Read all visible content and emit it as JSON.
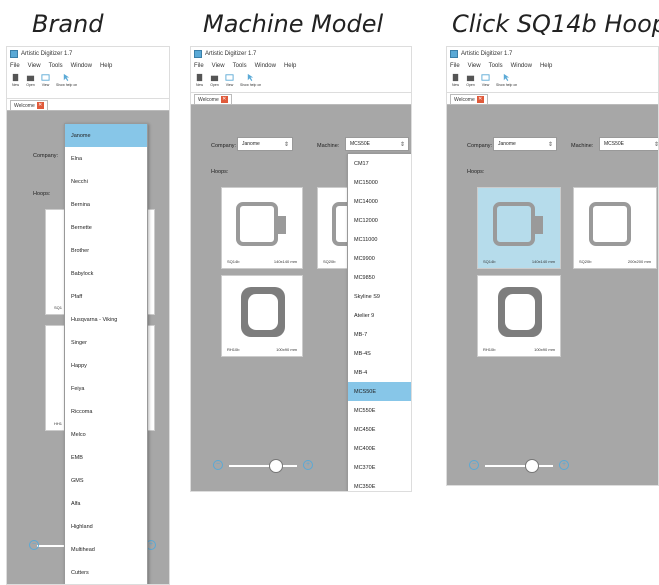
{
  "captions": {
    "brand": "Brand",
    "machine_model": "Machine Model",
    "click_hoop": "Click SQ14b Hoop"
  },
  "app": {
    "title": "Artistic Digitizer 1.7",
    "menu": [
      "File",
      "View",
      "Tools",
      "Window",
      "Help"
    ],
    "toolbar": [
      "New",
      "Open",
      "View",
      "Show help on"
    ],
    "tab_label": "Welcome"
  },
  "panel1": {
    "company_label": "Company:",
    "hoops_label": "Hoops:",
    "hoop_name_1": "SQ1",
    "hoop_name_2": "HH1",
    "brands": [
      "Janome",
      "Elna",
      "Necchi",
      "Bernina",
      "Bernette",
      "Brother",
      "Babylock",
      "Pfaff",
      "Husqvarna - Viking",
      "Singer",
      "Happy",
      "Feiya",
      "Riccoma",
      "Melco",
      "EMB",
      "GMS",
      "Alfa",
      "Highland",
      "Multihead",
      "Cutters"
    ],
    "selected_brand": "Janome"
  },
  "panel2": {
    "company_label": "Company:",
    "company_value": "Janome",
    "machine_label": "Machine:",
    "machine_value": "MCS50E",
    "hoops_label": "Hoops:",
    "hoops": [
      {
        "name": "SQ14b",
        "size": "140x140 mm"
      },
      {
        "name": "SQ20b",
        "size": ""
      },
      {
        "name": "RH10b",
        "size": "100x90 mm"
      }
    ],
    "machines": [
      "CM17",
      "MC15000",
      "MC14000",
      "MC12000",
      "MC11000",
      "MC9900",
      "MC9850",
      "Skyline S9",
      "Atelier 9",
      "MB-7",
      "MB-4S",
      "MB-4",
      "MCS50E",
      "MC550E",
      "MC450E",
      "MC400E",
      "MC370E",
      "MC350E"
    ],
    "selected_machine": "MCS50E"
  },
  "panel3": {
    "company_label": "Company:",
    "company_value": "Janome",
    "machine_label": "Machine:",
    "machine_value": "MCS50E",
    "hoops_label": "Hoops:",
    "hoops": [
      {
        "name": "SQ14b",
        "size": "140x140 mm"
      },
      {
        "name": "SQ20b",
        "size": "200x200 mm"
      },
      {
        "name": "RH10b",
        "size": "100x90 mm"
      }
    ],
    "selected_hoop": "SQ14b"
  },
  "colors": {
    "content_bg": "#a7a7a7",
    "highlight": "#87c6e8",
    "selected_card": "#b6dceb",
    "accent": "#5aa9d6"
  }
}
